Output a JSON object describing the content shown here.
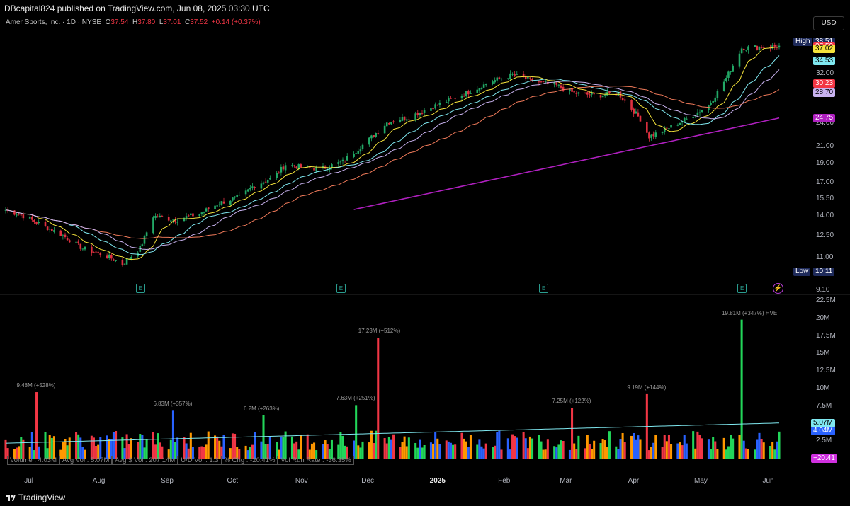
{
  "header": {
    "publisher": "DBcapital824 published on TradingView.com, Jun 08, 2025 03:30 UTC",
    "currency": "USD"
  },
  "legend": {
    "symbol": "Amer Sports, Inc. · 1D · NYSE",
    "o_label": "O",
    "o": "37.54",
    "h_label": "H",
    "h": "37.80",
    "l_label": "L",
    "l": "37.01",
    "c_label": "C",
    "c": "37.52",
    "change": "+0.14 (+0.37%)"
  },
  "price_labels": [
    {
      "text": "High",
      "value": "38.51",
      "bg": "#1e2a5a",
      "fg": "#ffffff"
    },
    {
      "text": "",
      "value": "37.52",
      "bg": "#f23645",
      "fg": "#ffffff"
    },
    {
      "text": "",
      "value": "37.02",
      "bg": "#f5e33b",
      "fg": "#000000"
    },
    {
      "text": "",
      "value": "34.53",
      "bg": "#7fe8f0",
      "fg": "#000000"
    },
    {
      "text": "",
      "value": "30.23",
      "bg": "#f23645",
      "fg": "#ffffff"
    },
    {
      "text": "",
      "value": "28.70",
      "bg": "#c9b3f0",
      "fg": "#000000"
    },
    {
      "text": "",
      "value": "24.75",
      "bg": "#b020c0",
      "fg": "#ffffff"
    },
    {
      "text": "Low",
      "value": "10.11",
      "bg": "#1e2a5a",
      "fg": "#ffffff"
    }
  ],
  "volume_labels": [
    {
      "value": "5.07M",
      "bg": "#7fe8f0",
      "fg": "#000000"
    },
    {
      "value": "4.04M",
      "bg": "#2962ff",
      "fg": "#ffffff"
    },
    {
      "value": "−20.41",
      "bg": "#d030e0",
      "fg": "#ffffff"
    }
  ],
  "stats": {
    "volume": "Volume : 4.03M",
    "avg_vol": "Avg Vol : 5.07M",
    "avg_dollar_vol": "Avg $ Vol : 207.14M",
    "ud_vol": "U/D Vol : 1.3",
    "pct_chg": "% Chg : -20.41%",
    "run_rate": "Vol Run Rate : -36.35%"
  },
  "volume_annotations": [
    {
      "text": "9.48M (+528%)"
    },
    {
      "text": "6.83M (+357%)"
    },
    {
      "text": "6.2M (+263%)"
    },
    {
      "text": "7.63M (+251%)"
    },
    {
      "text": "17.23M (+512%)"
    },
    {
      "text": "7.25M (+122%)"
    },
    {
      "text": "9.19M (+144%)"
    },
    {
      "text": "19.81M (+347%) HVE"
    }
  ],
  "earnings_marker": "E",
  "footer": {
    "brand": "TradingView"
  },
  "chart_data": [
    {
      "type": "candlestick",
      "title": "Amer Sports, Inc. · 1D · NYSE",
      "y_scale": "log",
      "ylim": [
        9.1,
        40
      ],
      "y_ticks": [
        "38.51",
        "37.52",
        "37.02",
        "34.53",
        "32.00",
        "30.23",
        "28.70",
        "24.75",
        "24.00",
        "21.00",
        "19.00",
        "17.00",
        "15.50",
        "14.00",
        "12.50",
        "11.00",
        "10.11",
        "9.10"
      ],
      "x_ticks": [
        "Jul",
        "Aug",
        "Sep",
        "Oct",
        "Nov",
        "Dec",
        "2025",
        "Feb",
        "Mar",
        "Apr",
        "May",
        "Jun"
      ],
      "x_range": [
        "2024-06-20",
        "2025-06-06"
      ],
      "close_path": [
        [
          "2024-06-20",
          14.5
        ],
        [
          "2024-06-27",
          14.1
        ],
        [
          "2024-07-05",
          13.4
        ],
        [
          "2024-07-15",
          12.6
        ],
        [
          "2024-07-25",
          11.6
        ],
        [
          "2024-08-05",
          11.1
        ],
        [
          "2024-08-12",
          10.6
        ],
        [
          "2024-08-20",
          11.6
        ],
        [
          "2024-08-26",
          14.0
        ],
        [
          "2024-09-05",
          13.7
        ],
        [
          "2024-09-16",
          14.2
        ],
        [
          "2024-09-25",
          15.1
        ],
        [
          "2024-10-05",
          15.7
        ],
        [
          "2024-10-10",
          16.6
        ],
        [
          "2024-10-20",
          17.6
        ],
        [
          "2024-10-25",
          18.9
        ],
        [
          "2024-11-01",
          18.6
        ],
        [
          "2024-11-10",
          18.4
        ],
        [
          "2024-11-20",
          19.2
        ],
        [
          "2024-12-01",
          21.6
        ],
        [
          "2024-12-10",
          24.1
        ],
        [
          "2024-12-20",
          24.9
        ],
        [
          "2025-01-01",
          26.6
        ],
        [
          "2025-01-15",
          28.6
        ],
        [
          "2025-01-27",
          30.7
        ],
        [
          "2025-02-05",
          31.8
        ],
        [
          "2025-02-15",
          30.6
        ],
        [
          "2025-02-25",
          29.9
        ],
        [
          "2025-03-05",
          28.6
        ],
        [
          "2025-03-15",
          28.2
        ],
        [
          "2025-03-25",
          28.6
        ],
        [
          "2025-04-04",
          24.6
        ],
        [
          "2025-04-08",
          22.2
        ],
        [
          "2025-04-15",
          23.1
        ],
        [
          "2025-04-25",
          24.6
        ],
        [
          "2025-05-05",
          26.6
        ],
        [
          "2025-05-13",
          31.2
        ],
        [
          "2025-05-20",
          37.2
        ],
        [
          "2025-05-28",
          37.4
        ],
        [
          "2025-06-06",
          37.52
        ]
      ],
      "moving_averages": [
        {
          "color": "#f5e33b",
          "last": 37.02
        },
        {
          "color": "#7fe8f0",
          "last": 34.53
        },
        {
          "color": "#f07a5a",
          "last": 30.23
        },
        {
          "color": "#c9b3f0",
          "last": 28.7
        },
        {
          "color": "#b020c0",
          "last": 24.75,
          "start": "2024-11-24"
        }
      ],
      "reference_levels": [
        {
          "value": 38.51,
          "label": "High"
        },
        {
          "value": 10.11,
          "label": "Low"
        },
        {
          "value": 37.52,
          "label": "last"
        }
      ],
      "earnings_dates": [
        "2024-08-20",
        "2024-11-19",
        "2025-02-19",
        "2025-05-20"
      ]
    },
    {
      "type": "bar",
      "title": "Volume",
      "ylim": [
        0,
        22.5
      ],
      "y_ticks": [
        "22.5M",
        "20M",
        "17.5M",
        "15M",
        "12.5M",
        "10M",
        "7.5M",
        "5.07M",
        "4.04M",
        "2.5M",
        "−20.41"
      ],
      "unit": "M",
      "annotated_bars": [
        {
          "date": "2024-07-04",
          "value": 9.48,
          "color": "#f23645"
        },
        {
          "date": "2024-09-04",
          "value": 6.83,
          "color": "#2962ff"
        },
        {
          "date": "2024-10-15",
          "value": 6.2,
          "color": "#22d65a"
        },
        {
          "date": "2024-11-26",
          "value": 7.63,
          "color": "#22d65a"
        },
        {
          "date": "2024-12-06",
          "value": 17.23,
          "color": "#f23645"
        },
        {
          "date": "2025-03-04",
          "value": 7.25,
          "color": "#f23645"
        },
        {
          "date": "2025-04-07",
          "value": 9.19,
          "color": "#f23645"
        },
        {
          "date": "2025-05-20",
          "value": 19.81,
          "color": "#22d65a"
        }
      ],
      "average_volume": 5.07,
      "last_volume": 4.04
    }
  ]
}
